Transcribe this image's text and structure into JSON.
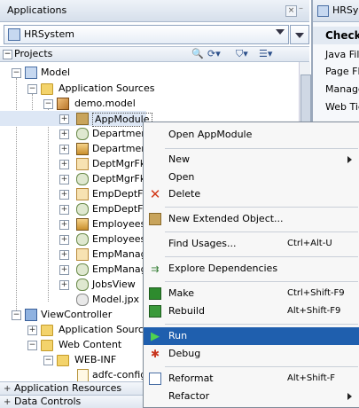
{
  "applications_panel": {
    "title": "Applications",
    "selected_application": "HRSystem",
    "projects_label": "Projects",
    "accordion": [
      "Application Resources",
      "Data Controls"
    ]
  },
  "tree": {
    "model": "Model",
    "application_sources": "Application Sources",
    "package": "demo.model",
    "items": [
      "AppModule",
      "Department",
      "Department",
      "DeptMgrFkA",
      "DeptMgrFkL",
      "EmpDeptFkA",
      "EmpDeptFkl",
      "Employees",
      "EmployeesV",
      "EmpManage",
      "EmpManage",
      "JobsView",
      "Model.jpx"
    ],
    "view_controller": "ViewController",
    "vc_application_sources": "Application Sources",
    "web_content": "Web Content",
    "web_inf": "WEB-INF",
    "adfc_config": "adfc-config"
  },
  "right_panel": {
    "tab": "HRSys",
    "header": "Checkli",
    "items": [
      "Java File",
      "Page Flo",
      "Manage",
      "Web Tie"
    ]
  },
  "context_menu": {
    "items": [
      {
        "label": "Open AppModule",
        "shortcut": "",
        "icon": ""
      },
      {
        "label": "New",
        "shortcut": "",
        "icon": "",
        "submenu": true
      },
      {
        "label": "Open",
        "shortcut": "",
        "icon": ""
      },
      {
        "label": "Delete",
        "shortcut": "",
        "icon": "delete-x-icon"
      },
      {
        "label": "New Extended Object...",
        "shortcut": "",
        "icon": "extended-object-icon"
      },
      {
        "label": "Find Usages...",
        "shortcut": "Ctrl+Alt-U",
        "icon": ""
      },
      {
        "label": "Explore Dependencies",
        "shortcut": "",
        "icon": "dependencies-icon"
      },
      {
        "label": "Make",
        "shortcut": "Ctrl+Shift-F9",
        "icon": "make-icon"
      },
      {
        "label": "Rebuild",
        "shortcut": "Alt+Shift-F9",
        "icon": "rebuild-icon"
      },
      {
        "label": "Run",
        "shortcut": "",
        "icon": "run-icon"
      },
      {
        "label": "Debug",
        "shortcut": "",
        "icon": "debug-icon"
      },
      {
        "label": "Reformat",
        "shortcut": "Alt+Shift-F",
        "icon": "reformat-icon"
      },
      {
        "label": "Refactor",
        "shortcut": "",
        "icon": "",
        "submenu": true
      }
    ]
  },
  "colors": {
    "menu_highlight": "#1f5fae",
    "panel_header": "#dfe6f0"
  }
}
